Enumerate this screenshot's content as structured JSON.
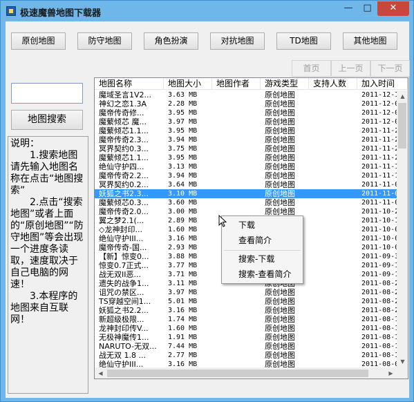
{
  "window": {
    "title": "极速魔兽地图下载器",
    "close_symbol": "✕",
    "max_symbol": "□",
    "min_symbol": "—"
  },
  "categories": [
    "原创地图",
    "防守地图",
    "角色扮演",
    "对抗地图",
    "TD地图",
    "其他地图"
  ],
  "pager": {
    "first": "首页",
    "prev": "上一页",
    "next": "下一页"
  },
  "search": {
    "value": "",
    "button": "地图搜索"
  },
  "info": {
    "heading": "说明：",
    "p1": "1.搜索地图请先输入地图名称在点击“地图搜索”",
    "p2": "2.点击“搜索地图”或者上面的“原创地图”“防守地图”等会出现一个进度条读取，速度取决于自己电脑的网速！",
    "p3": "3.本程序的地图来自互联网！"
  },
  "table": {
    "columns": [
      "地图名称",
      "地图大小",
      "地图作者",
      "游戏类型",
      "支持人数",
      "加入时间"
    ],
    "rows": [
      [
        "魔域圣言1V2...",
        "3.63 MB",
        "",
        "原创地图",
        "",
        "2011-12-1"
      ],
      [
        "神幻之恋1.3A",
        "2.28 MB",
        "",
        "原创地图",
        "",
        "2011-12-0"
      ],
      [
        "魔帝传奇修...",
        "3.95 MB",
        "",
        "原创地图",
        "",
        "2011-12-0"
      ],
      [
        "魔蘩倾芯 魔...",
        "3.97 MB",
        "",
        "原创地图",
        "",
        "2011-12-0"
      ],
      [
        "魔蘩倾芯1.1...",
        "3.95 MB",
        "",
        "原创地图",
        "",
        "2011-11-2"
      ],
      [
        "魔帝传奇2.3...",
        "3.94 MB",
        "",
        "原创地图",
        "",
        "2011-11-2"
      ],
      [
        "冥界契约0.3...",
        "3.75 MB",
        "",
        "原创地图",
        "",
        "2011-11-2"
      ],
      [
        "魔蘩倾芯1.1...",
        "3.95 MB",
        "",
        "原创地图",
        "",
        "2011-11-2"
      ],
      [
        "绝仙守护四...",
        "3.13 MB",
        "",
        "原创地图",
        "",
        "2011-11-1"
      ],
      [
        "魔帝传奇2.2...",
        "3.94 MB",
        "",
        "原创地图",
        "",
        "2011-11-1"
      ],
      [
        "冥界契约0.2...",
        "3.64 MB",
        "",
        "原创地图",
        "",
        "2011-11-0"
      ],
      [
        "妖狐之书2.3...",
        "3.10 MB",
        "",
        "原创地图",
        "",
        "2011-11-0"
      ],
      [
        "魔蘩倾芯0.3...",
        "3.60 MB",
        "",
        "原创地图",
        "",
        "2011-11-0"
      ],
      [
        "魔帝传奇2.0...",
        "3.00 MB",
        "",
        "原创地图",
        "",
        "2011-10-2"
      ],
      [
        "翼之梦2.1(...",
        "2.89 MB",
        "",
        "原创地图",
        "",
        "2011-10-1"
      ],
      [
        "◇龙神封印...",
        "1.60 MB",
        "",
        "原创地图",
        "",
        "2011-10-0"
      ],
      [
        "绝仙守护III...",
        "3.16 MB",
        "",
        "原创地图",
        "",
        "2011-10-0"
      ],
      [
        "魔帝传奇-国...",
        "2.93 MB",
        "",
        "原创地图",
        "",
        "2011-10-0"
      ],
      [
        "【新】惊变0...",
        "3.88 MB",
        "",
        "原创地图",
        "",
        "2011-09-3"
      ],
      [
        "惊变0.7正式...",
        "3.77 MB",
        "",
        "原创地图",
        "",
        "2011-09-1"
      ],
      [
        "战无双II恶...",
        "3.71 MB",
        "",
        "原创地图",
        "",
        "2011-09-1"
      ],
      [
        "遗失的战争1...",
        "3.11 MB",
        "",
        "原创地图",
        "",
        "2011-08-2"
      ],
      [
        "诅咒の禁区...",
        "3.97 MB",
        "",
        "原创地图",
        "",
        "2011-08-2"
      ],
      [
        "TS穿越空间1...",
        "5.01 MB",
        "",
        "原创地图",
        "",
        "2011-08-2"
      ],
      [
        "妖狐之书2.2...",
        "3.16 MB",
        "",
        "原创地图",
        "",
        "2011-08-2"
      ],
      [
        "新超级极限...",
        "1.74 MB",
        "",
        "原创地图",
        "",
        "2011-08-1"
      ],
      [
        "龙神封印传V...",
        "1.60 MB",
        "",
        "原创地图",
        "",
        "2011-08-1"
      ],
      [
        "无极神魔传1...",
        "1.91 MB",
        "",
        "原创地图",
        "",
        "2011-08-1"
      ],
      [
        "NARUTO-无双...",
        "7.44 MB",
        "",
        "原创地图",
        "",
        "2011-08-1"
      ],
      [
        "战无双 1.8 ...",
        "2.77 MB",
        "",
        "原创地图",
        "",
        "2011-08-1"
      ],
      [
        "绝仙守护III...",
        "3.16 MB",
        "",
        "原创地图",
        "",
        "2011-08-0"
      ]
    ],
    "selected_index": 11
  },
  "context_menu": {
    "items": [
      "下载",
      "查看简介",
      "搜索-下载",
      "搜索-查看简介"
    ]
  },
  "colors": {
    "title_bar": "#6fb6e9",
    "selection": "#3399ff",
    "close_button": "#c9463d"
  }
}
